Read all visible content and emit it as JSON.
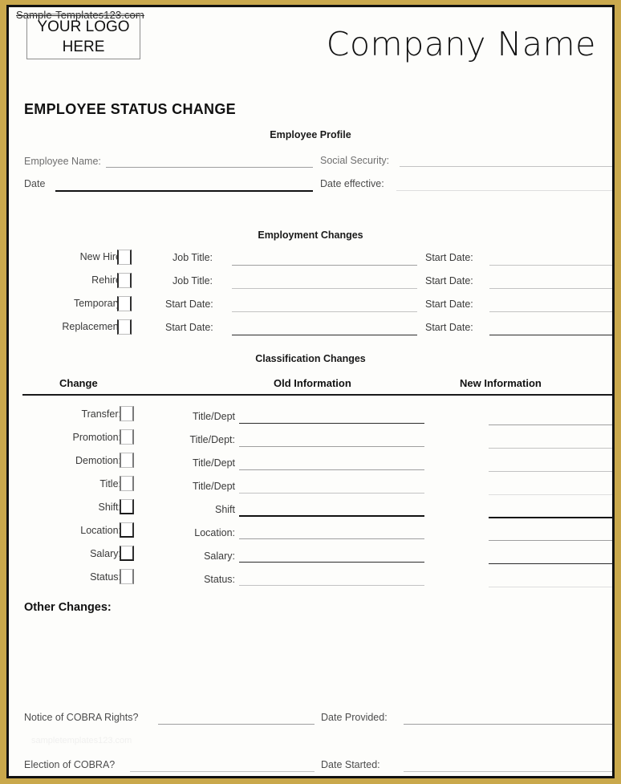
{
  "watermark": {
    "top": "Sample-Templates123.com",
    "bottom": "sampletemplates123.com"
  },
  "header": {
    "logo_line1": "YOUR LOGO",
    "logo_line2": "HERE",
    "company_name": "Company Name",
    "form_title": "EMPLOYEE STATUS CHANGE"
  },
  "employee_profile": {
    "heading": "Employee Profile",
    "employee_name_label": "Employee Name:",
    "social_security_label": "Social Security:",
    "date_label": "Date",
    "date_effective_label": "Date effective:"
  },
  "employment_changes": {
    "heading": "Employment Changes",
    "rows": [
      {
        "change": "New Hire",
        "field": "Job Title:",
        "start": "Start Date:"
      },
      {
        "change": "Rehire",
        "field": "Job Title:",
        "start": "Start Date:"
      },
      {
        "change": "Temporary",
        "field": "Start Date:",
        "start": "Start Date:"
      },
      {
        "change": "Replacement",
        "field": "Start Date:",
        "start": "Start Date:"
      }
    ]
  },
  "classification_changes": {
    "heading": "Classification Changes",
    "col_change": "Change",
    "col_old": "Old Information",
    "col_new": "New Information",
    "rows": [
      {
        "change": "Transfer:",
        "field": "Title/Dept"
      },
      {
        "change": "Promotion:",
        "field": "Title/Dept:"
      },
      {
        "change": "Demotion:",
        "field": "Title/Dept"
      },
      {
        "change": "Title:",
        "field": "Title/Dept"
      },
      {
        "change": "Shift:",
        "field": "Shift"
      },
      {
        "change": "Location:",
        "field": "Location:"
      },
      {
        "change": "Salary:",
        "field": "Salary:"
      },
      {
        "change": "Status:",
        "field": "Status:"
      }
    ]
  },
  "other_changes": {
    "heading": "Other Changes:"
  },
  "cobra": {
    "notice_label": "Notice of COBRA Rights?",
    "date_provided_label": "Date Provided:",
    "election_label": "Election of COBRA?",
    "date_started_label": "Date Started:"
  }
}
